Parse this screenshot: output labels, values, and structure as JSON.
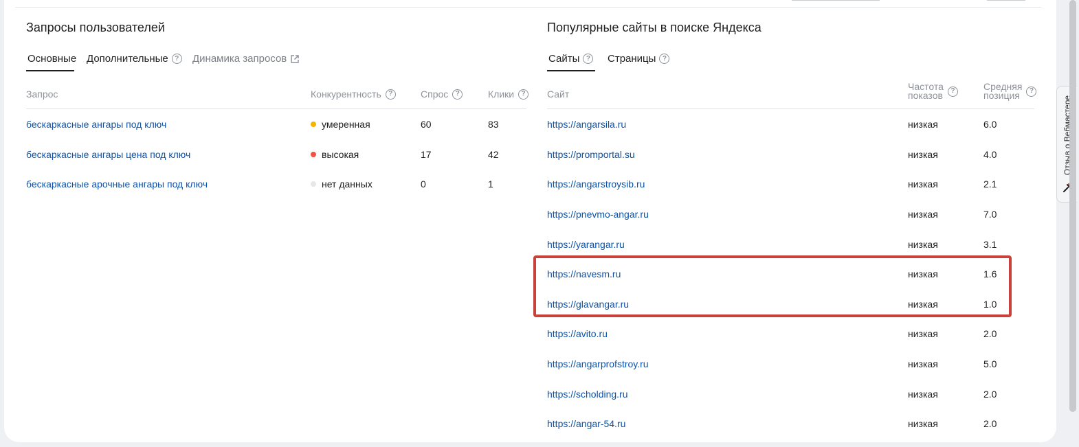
{
  "left_panel": {
    "title": "Запросы пользователей",
    "tabs": {
      "main": "Основные",
      "extra": "Дополнительные",
      "dynamics": "Динамика запросов"
    },
    "columns": {
      "query": "Запрос",
      "competition": "Конкурентность",
      "demand": "Спрос",
      "clicks": "Клики"
    },
    "rows": [
      {
        "query": "бескаркасные ангары под ключ",
        "competition": "умеренная",
        "dot_color": "#f5b400",
        "demand": "60",
        "clicks": "83"
      },
      {
        "query": "бескаркасные ангары цена под ключ",
        "competition": "высокая",
        "dot_color": "#f0523f",
        "demand": "17",
        "clicks": "42"
      },
      {
        "query": "бескаркасные арочные ангары под ключ",
        "competition": "нет данных",
        "dot_color": "#e6e7e9",
        "demand": "0",
        "clicks": "1"
      }
    ]
  },
  "right_panel": {
    "title": "Популярные сайты в поиске Яндекса",
    "tabs": {
      "sites": "Сайты",
      "pages": "Страницы"
    },
    "columns": {
      "site": "Сайт",
      "freq_line1": "Частота",
      "freq_line2": "показов",
      "pos_line1": "Средняя",
      "pos_line2": "позиция"
    },
    "rows": [
      {
        "site": "https://angarsila.ru",
        "freq": "низкая",
        "pos": "6.0"
      },
      {
        "site": "https://promportal.su",
        "freq": "низкая",
        "pos": "4.0"
      },
      {
        "site": "https://angarstroysib.ru",
        "freq": "низкая",
        "pos": "2.1"
      },
      {
        "site": "https://pnevmo-angar.ru",
        "freq": "низкая",
        "pos": "7.0"
      },
      {
        "site": "https://yarangar.ru",
        "freq": "низкая",
        "pos": "3.1"
      },
      {
        "site": "https://navesm.ru",
        "freq": "низкая",
        "pos": "1.6"
      },
      {
        "site": "https://glavangar.ru",
        "freq": "низкая",
        "pos": "1.0"
      },
      {
        "site": "https://avito.ru",
        "freq": "низкая",
        "pos": "2.0"
      },
      {
        "site": "https://angarprofstroy.ru",
        "freq": "низкая",
        "pos": "5.0"
      },
      {
        "site": "https://scholding.ru",
        "freq": "низкая",
        "pos": "2.0"
      },
      {
        "site": "https://angar-54.ru",
        "freq": "низкая",
        "pos": "2.0"
      }
    ]
  },
  "feedback": {
    "label": "Отзыв о Вебмастере"
  },
  "colors": {
    "link": "#0b52a8",
    "highlight": "#c8413b",
    "moderate": "#f5b400",
    "high": "#f0523f",
    "no_data": "#e6e7e9"
  }
}
